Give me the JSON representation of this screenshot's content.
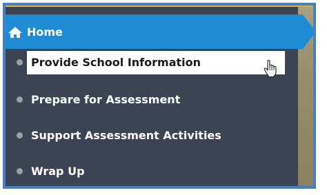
{
  "nav": {
    "home_label": "Home",
    "items": [
      {
        "label": "Provide School Information",
        "selected": true
      },
      {
        "label": "Prepare for Assessment",
        "selected": false
      },
      {
        "label": "Support Assessment Activities",
        "selected": false
      },
      {
        "label": "Wrap Up",
        "selected": false
      }
    ]
  },
  "icons": {
    "home": "home-icon",
    "bullet": "bullet-icon",
    "cursor": "hand-pointer-icon"
  },
  "colors": {
    "nav_background": "#3c4453",
    "home_bar": "#1f8bd2",
    "frame_border": "#4a7fc4",
    "accent_line": "#d8b23a",
    "selected_background": "#ffffff"
  }
}
